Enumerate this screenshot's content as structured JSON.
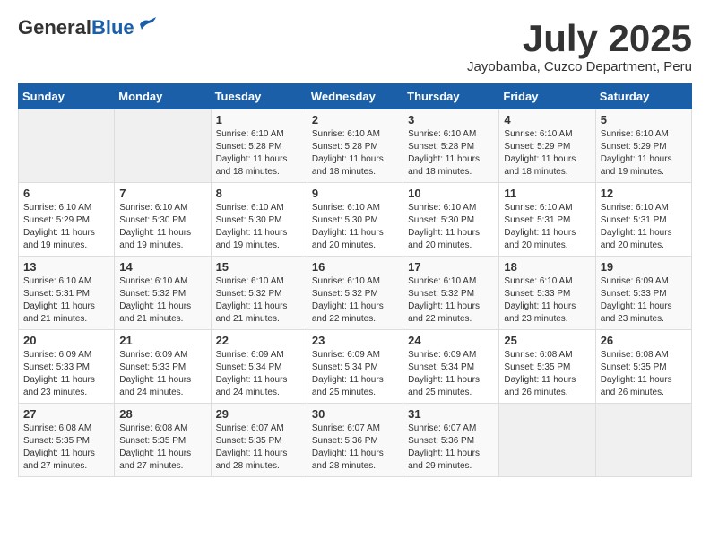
{
  "logo": {
    "general": "General",
    "blue": "Blue"
  },
  "header": {
    "month": "July 2025",
    "location": "Jayobamba, Cuzco Department, Peru"
  },
  "weekdays": [
    "Sunday",
    "Monday",
    "Tuesday",
    "Wednesday",
    "Thursday",
    "Friday",
    "Saturday"
  ],
  "weeks": [
    [
      {
        "day": "",
        "info": ""
      },
      {
        "day": "",
        "info": ""
      },
      {
        "day": "1",
        "info": "Sunrise: 6:10 AM\nSunset: 5:28 PM\nDaylight: 11 hours and 18 minutes."
      },
      {
        "day": "2",
        "info": "Sunrise: 6:10 AM\nSunset: 5:28 PM\nDaylight: 11 hours and 18 minutes."
      },
      {
        "day": "3",
        "info": "Sunrise: 6:10 AM\nSunset: 5:28 PM\nDaylight: 11 hours and 18 minutes."
      },
      {
        "day": "4",
        "info": "Sunrise: 6:10 AM\nSunset: 5:29 PM\nDaylight: 11 hours and 18 minutes."
      },
      {
        "day": "5",
        "info": "Sunrise: 6:10 AM\nSunset: 5:29 PM\nDaylight: 11 hours and 19 minutes."
      }
    ],
    [
      {
        "day": "6",
        "info": "Sunrise: 6:10 AM\nSunset: 5:29 PM\nDaylight: 11 hours and 19 minutes."
      },
      {
        "day": "7",
        "info": "Sunrise: 6:10 AM\nSunset: 5:30 PM\nDaylight: 11 hours and 19 minutes."
      },
      {
        "day": "8",
        "info": "Sunrise: 6:10 AM\nSunset: 5:30 PM\nDaylight: 11 hours and 19 minutes."
      },
      {
        "day": "9",
        "info": "Sunrise: 6:10 AM\nSunset: 5:30 PM\nDaylight: 11 hours and 20 minutes."
      },
      {
        "day": "10",
        "info": "Sunrise: 6:10 AM\nSunset: 5:30 PM\nDaylight: 11 hours and 20 minutes."
      },
      {
        "day": "11",
        "info": "Sunrise: 6:10 AM\nSunset: 5:31 PM\nDaylight: 11 hours and 20 minutes."
      },
      {
        "day": "12",
        "info": "Sunrise: 6:10 AM\nSunset: 5:31 PM\nDaylight: 11 hours and 20 minutes."
      }
    ],
    [
      {
        "day": "13",
        "info": "Sunrise: 6:10 AM\nSunset: 5:31 PM\nDaylight: 11 hours and 21 minutes."
      },
      {
        "day": "14",
        "info": "Sunrise: 6:10 AM\nSunset: 5:32 PM\nDaylight: 11 hours and 21 minutes."
      },
      {
        "day": "15",
        "info": "Sunrise: 6:10 AM\nSunset: 5:32 PM\nDaylight: 11 hours and 21 minutes."
      },
      {
        "day": "16",
        "info": "Sunrise: 6:10 AM\nSunset: 5:32 PM\nDaylight: 11 hours and 22 minutes."
      },
      {
        "day": "17",
        "info": "Sunrise: 6:10 AM\nSunset: 5:32 PM\nDaylight: 11 hours and 22 minutes."
      },
      {
        "day": "18",
        "info": "Sunrise: 6:10 AM\nSunset: 5:33 PM\nDaylight: 11 hours and 23 minutes."
      },
      {
        "day": "19",
        "info": "Sunrise: 6:09 AM\nSunset: 5:33 PM\nDaylight: 11 hours and 23 minutes."
      }
    ],
    [
      {
        "day": "20",
        "info": "Sunrise: 6:09 AM\nSunset: 5:33 PM\nDaylight: 11 hours and 23 minutes."
      },
      {
        "day": "21",
        "info": "Sunrise: 6:09 AM\nSunset: 5:33 PM\nDaylight: 11 hours and 24 minutes."
      },
      {
        "day": "22",
        "info": "Sunrise: 6:09 AM\nSunset: 5:34 PM\nDaylight: 11 hours and 24 minutes."
      },
      {
        "day": "23",
        "info": "Sunrise: 6:09 AM\nSunset: 5:34 PM\nDaylight: 11 hours and 25 minutes."
      },
      {
        "day": "24",
        "info": "Sunrise: 6:09 AM\nSunset: 5:34 PM\nDaylight: 11 hours and 25 minutes."
      },
      {
        "day": "25",
        "info": "Sunrise: 6:08 AM\nSunset: 5:35 PM\nDaylight: 11 hours and 26 minutes."
      },
      {
        "day": "26",
        "info": "Sunrise: 6:08 AM\nSunset: 5:35 PM\nDaylight: 11 hours and 26 minutes."
      }
    ],
    [
      {
        "day": "27",
        "info": "Sunrise: 6:08 AM\nSunset: 5:35 PM\nDaylight: 11 hours and 27 minutes."
      },
      {
        "day": "28",
        "info": "Sunrise: 6:08 AM\nSunset: 5:35 PM\nDaylight: 11 hours and 27 minutes."
      },
      {
        "day": "29",
        "info": "Sunrise: 6:07 AM\nSunset: 5:35 PM\nDaylight: 11 hours and 28 minutes."
      },
      {
        "day": "30",
        "info": "Sunrise: 6:07 AM\nSunset: 5:36 PM\nDaylight: 11 hours and 28 minutes."
      },
      {
        "day": "31",
        "info": "Sunrise: 6:07 AM\nSunset: 5:36 PM\nDaylight: 11 hours and 29 minutes."
      },
      {
        "day": "",
        "info": ""
      },
      {
        "day": "",
        "info": ""
      }
    ]
  ]
}
